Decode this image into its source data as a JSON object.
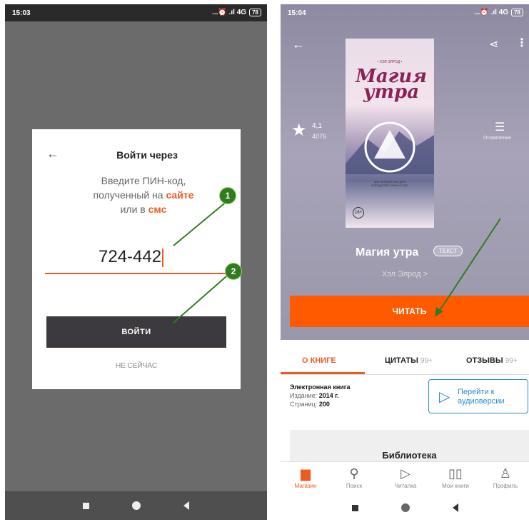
{
  "phone_left": {
    "status": {
      "time": "15:03",
      "network": "...⏰ .ıl 4G",
      "battery": "78"
    },
    "dialog": {
      "back_arrow": "←",
      "title": "Войти через",
      "line1": "Введите ПИН-код,",
      "line2_prefix": "полученный на ",
      "line2_link": "сайте",
      "line3_prefix": "или в ",
      "line3_link": "смс",
      "pin_value": "724-442",
      "login_label": "ВОЙТИ",
      "later_label": "НЕ СЕЙЧАС"
    },
    "callouts": [
      "1",
      "2"
    ]
  },
  "phone_right": {
    "status": {
      "time": "15:04",
      "network": "...⏰ .ıl 4G",
      "battery": "78"
    },
    "header": {
      "back_arrow": "←",
      "share_glyph": "⋖",
      "more_glyph": "⋮"
    },
    "cover": {
      "author": "• ХЭЛ ЭЛРОД •",
      "title_line1": "Магия",
      "title_line2": "утра",
      "subtitle_line1": "КАК ПЕРВЫЙ ЧАС ДНЯ",
      "subtitle_line2": "ОПРЕДЕЛЯЕТ ВАШ УСПЕХ",
      "age": "16+"
    },
    "rating": {
      "value": "4,1",
      "count": "4076"
    },
    "toc_label": "Оглавление",
    "book_title": "Магия утра",
    "format_badge": "ТЕКСТ",
    "author": "Хэл Элрод >",
    "read_label": "ЧИТАТЬ",
    "tabs": [
      {
        "label": "О КНИГЕ",
        "count": ""
      },
      {
        "label": "ЦИТАТЫ",
        "count": "99+"
      },
      {
        "label": "ОТЗЫВЫ",
        "count": "99+"
      }
    ],
    "info": {
      "kind": "Электронная книга",
      "edition_label": "Издание:",
      "edition_value": "2014 г.",
      "pages_label": "Страниц:",
      "pages_value": "200"
    },
    "audio_button": {
      "line1": "Перейти к",
      "line2": "аудиоверсии"
    },
    "library_heading": "Библиотека",
    "bottom_nav": [
      {
        "label": "Магазин",
        "icon": "store-icon"
      },
      {
        "label": "Поиск",
        "icon": "search-icon"
      },
      {
        "label": "Читалка",
        "icon": "play-icon"
      },
      {
        "label": "Мои книги",
        "icon": "book-icon"
      },
      {
        "label": "Профиль",
        "icon": "profile-icon"
      }
    ]
  },
  "colors": {
    "accent": "#f05a22",
    "read_button": "#ff5a00",
    "callout": "#2f7d1f",
    "audio": "#2a8cc9"
  }
}
